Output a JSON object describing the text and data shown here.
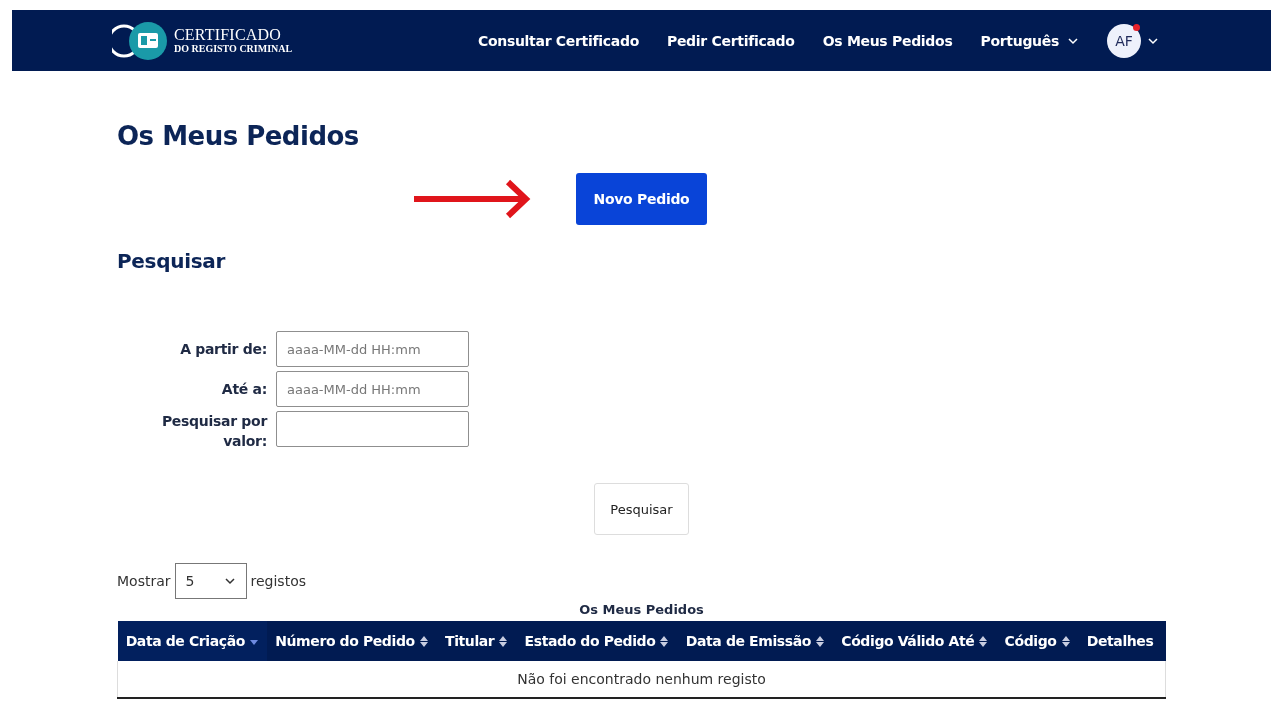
{
  "header": {
    "logo": {
      "title": "CERTIFICADO",
      "subtitle": "DO REGISTO CRIMINAL"
    },
    "nav": [
      {
        "label": "Consultar Certificado",
        "kind": "link"
      },
      {
        "label": "Pedir Certificado",
        "kind": "link"
      },
      {
        "label": "Os Meus Pedidos",
        "kind": "link"
      },
      {
        "label": "Português",
        "kind": "dropdown"
      }
    ],
    "user": {
      "initials": "AF",
      "notification": true
    }
  },
  "page_title": "Os Meus Pedidos",
  "new_button": "Novo Pedido",
  "search": {
    "title": "Pesquisar",
    "fields": [
      {
        "label": "A partir de:",
        "placeholder": "aaaa-MM-dd HH:mm"
      },
      {
        "label": "Até a:",
        "placeholder": "aaaa-MM-dd HH:mm"
      },
      {
        "label": "Pesquisar por valor:"
      }
    ],
    "button": "Pesquisar"
  },
  "page_size": {
    "prefix": "Mostrar",
    "value": "5",
    "suffix": "registos"
  },
  "table": {
    "caption": "Os Meus Pedidos",
    "columns": [
      {
        "label": "Data de Criação",
        "sortable": true,
        "selected": true
      },
      {
        "label": "Número do Pedido",
        "sortable": true,
        "selected": false
      },
      {
        "label": "Titular",
        "sortable": true,
        "selected": false
      },
      {
        "label": "Estado do Pedido",
        "sortable": true,
        "selected": false
      },
      {
        "label": "Data de Emissão",
        "sortable": true,
        "selected": false
      },
      {
        "label": "Código Válido Até",
        "sortable": true,
        "selected": false
      },
      {
        "label": "Código",
        "sortable": true,
        "selected": false
      },
      {
        "label": "Detalhes",
        "sortable": false,
        "selected": false
      }
    ],
    "empty_message": "Não foi encontrado nenhum registo"
  }
}
